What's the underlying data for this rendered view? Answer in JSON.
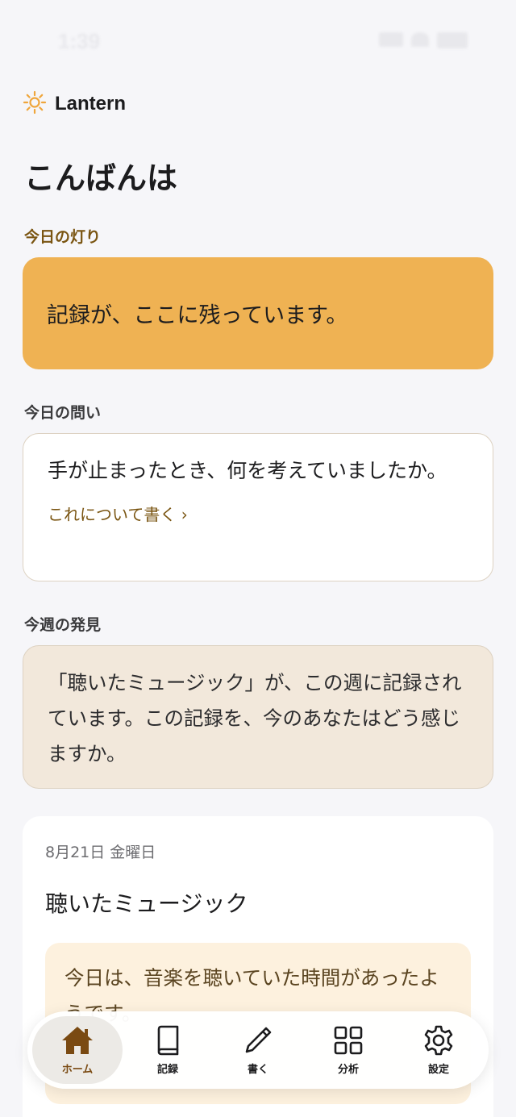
{
  "status_bar": {
    "time": "1:39"
  },
  "app": {
    "name": "Lantern",
    "logo_icon": "sun-icon"
  },
  "greeting": "こんばんは",
  "today_light": {
    "label": "今日の灯り",
    "text": "記録が、ここに残っています。",
    "color": "#efb253"
  },
  "today_question": {
    "label": "今日の問い",
    "text": "手が止まったとき、何を考えていましたか。",
    "link": "これについて書く ›"
  },
  "weekly_discovery": {
    "label": "今週の発見",
    "text": "「聴いたミュージック」が、この週に記録されています。この記録を、今のあなたはどう感じますか。"
  },
  "entry": {
    "date": "8月21日 金曜日",
    "title": "聴いたミュージック",
    "summary": "今日は、音楽を聴いていた時間があったようです。"
  },
  "tab_bar": {
    "tabs": [
      {
        "label": "ホーム",
        "icon": "home-icon",
        "active": true
      },
      {
        "label": "記録",
        "icon": "book-icon",
        "active": false
      },
      {
        "label": "書く",
        "icon": "pencil-icon",
        "active": false
      },
      {
        "label": "分析",
        "icon": "grid-icon",
        "active": false
      },
      {
        "label": "設定",
        "icon": "gear-icon",
        "active": false
      }
    ]
  },
  "colors": {
    "accent": "#7a5512",
    "background": "#f6f6f9"
  }
}
